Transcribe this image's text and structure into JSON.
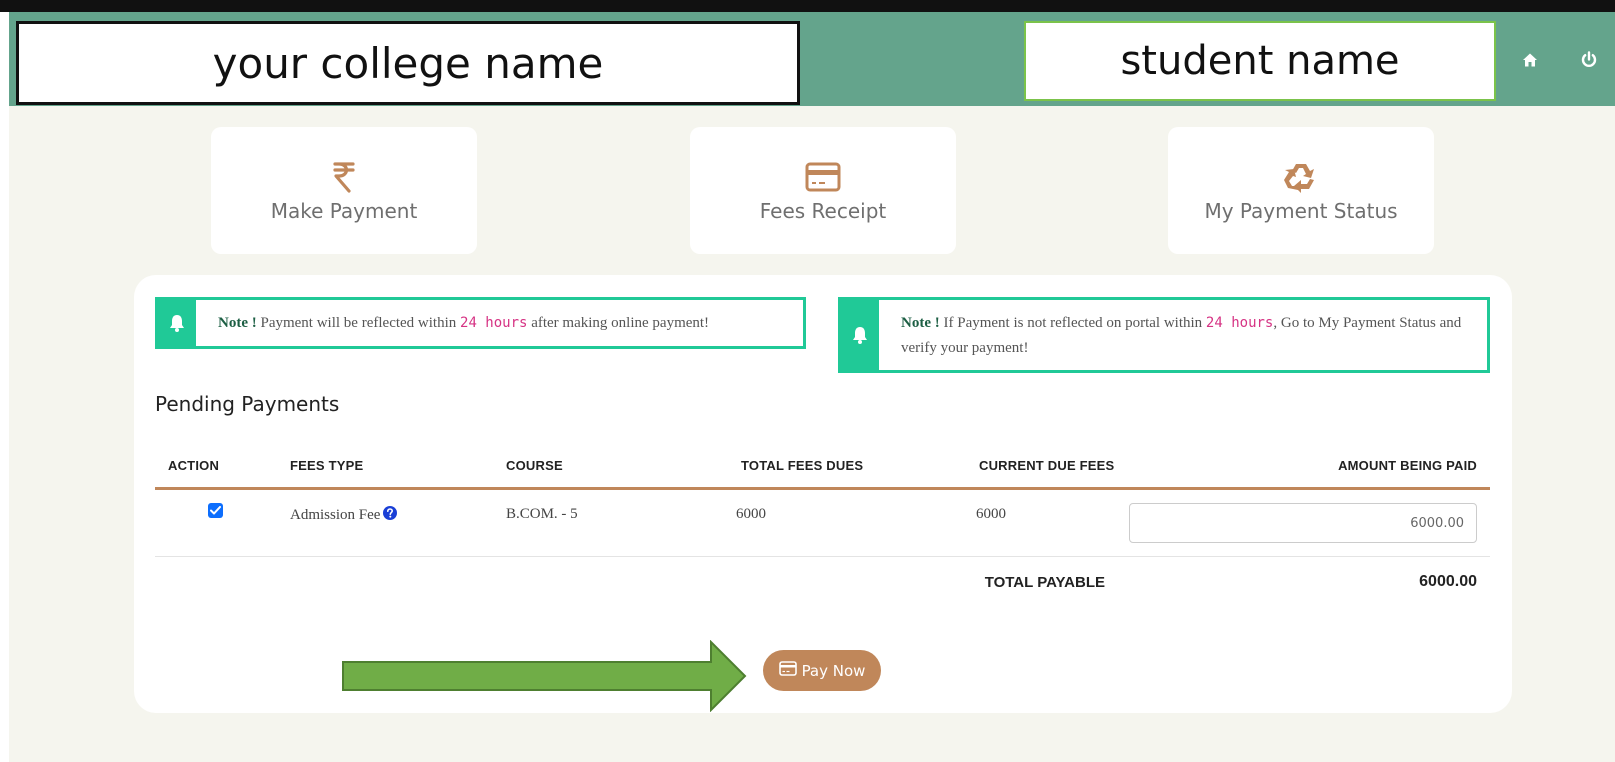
{
  "header": {
    "college_name": "your college name",
    "student_name": "student name",
    "home_icon": "home-icon",
    "power_icon": "power-icon",
    "bg_color": "#64a48c"
  },
  "tiles": [
    {
      "label": "Make Payment",
      "icon": "rupee-icon"
    },
    {
      "label": "Fees Receipt",
      "icon": "credit-card-icon"
    },
    {
      "label": "My Payment Status",
      "icon": "recycle-icon"
    }
  ],
  "notes": {
    "left": {
      "strong": "Note !",
      "text_before": " Payment will be reflected within ",
      "highlight": "24 hours",
      "text_after": " after making online payment!"
    },
    "right": {
      "strong": "Note !",
      "text_before": " If Payment is not reflected on portal within ",
      "highlight": "24 hours",
      "text_after": ", Go to My Payment Status and verify your payment!"
    },
    "accent_color": "#20c997"
  },
  "pending": {
    "title": "Pending Payments",
    "columns": [
      "ACTION",
      "FEES TYPE",
      "COURSE",
      "TOTAL FEES DUES",
      "CURRENT DUE FEES",
      "AMOUNT BEING PAID"
    ],
    "rows": [
      {
        "checked": true,
        "fees_type": "Admission Fee",
        "course": "B.COM. - 5",
        "total_fees_dues": "6000",
        "current_due_fees": "6000",
        "amount_being_paid": "6000.00"
      }
    ],
    "total_label": "TOTAL PAYABLE",
    "total_value": "6000.00"
  },
  "pay_button": {
    "label": "Pay Now",
    "color": "#c0875a"
  },
  "annotation_arrow_color": "#70ad47"
}
